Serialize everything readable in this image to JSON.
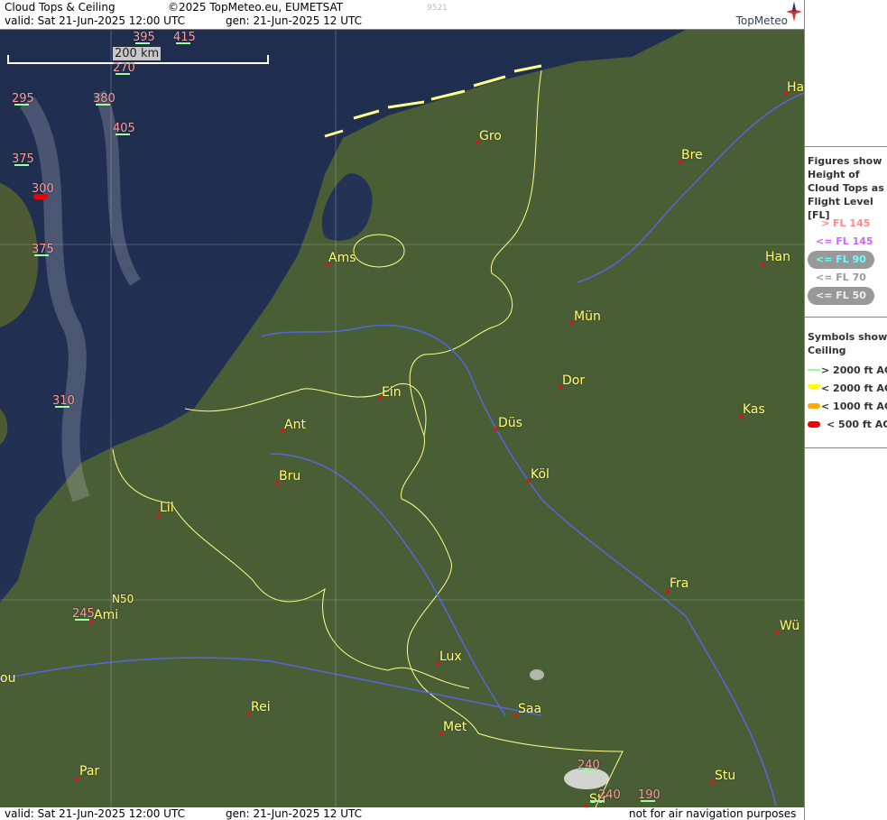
{
  "header": {
    "title": "Cloud Tops & Ceiling",
    "copyright": "©2025 TopMeteo.eu, EUMETSAT",
    "code": "9521",
    "valid": "valid:  Sat  21-Jun-2025  12:00 UTC",
    "gen": "gen:  21-Jun-2025 12 UTC",
    "logo": "TopMeteo"
  },
  "footer": {
    "valid": "valid:  Sat  21-Jun-2025  12:00 UTC",
    "gen": "gen:  21-Jun-2025 12 UTC",
    "disclaimer": "not for air navigation purposes"
  },
  "scale_label": "200 km",
  "grid_label": "N50",
  "legend": {
    "tops_title": "Figures show Height of Cloud Tops as Flight Level  [FL]",
    "tops_items": [
      {
        "label": "> FL 145",
        "color": "#ff8888"
      },
      {
        "label": "<= FL 145",
        "color": "#cc66ff"
      },
      {
        "label": "<= FL 90",
        "color": "#66ffff"
      },
      {
        "label": "<= FL 70",
        "color": "#999999"
      },
      {
        "label": "<= FL 50",
        "color": "#dddddd"
      }
    ],
    "ceiling_title": "Symbols show Ceiling",
    "ceiling_items": [
      {
        "label": "> 2000 ft AGL",
        "color": "#99ff99"
      },
      {
        "label": "< 2000 ft AGL",
        "color": "#ffff00"
      },
      {
        "label": "< 1000 ft AGL",
        "color": "#ffaa00"
      },
      {
        "label": "< 500 ft AGL",
        "color": "#ee0000"
      }
    ]
  },
  "cities": [
    "Ha",
    "Gro",
    "Bre",
    "Ams",
    "Han",
    "Mün",
    "Ein",
    "Dor",
    "Ant",
    "Düs",
    "Kas",
    "Bru",
    "Köl",
    "Lil",
    "Fra",
    "Ami",
    "Wü",
    "Lux",
    "ou",
    "Rei",
    "Saa",
    "Met",
    "Par",
    "Stu",
    "Str"
  ],
  "cloud_tops": [
    "395",
    "415",
    "270",
    "295",
    "380",
    "405",
    "375",
    "300",
    "375",
    "310",
    "245",
    "240",
    "240",
    "190"
  ]
}
